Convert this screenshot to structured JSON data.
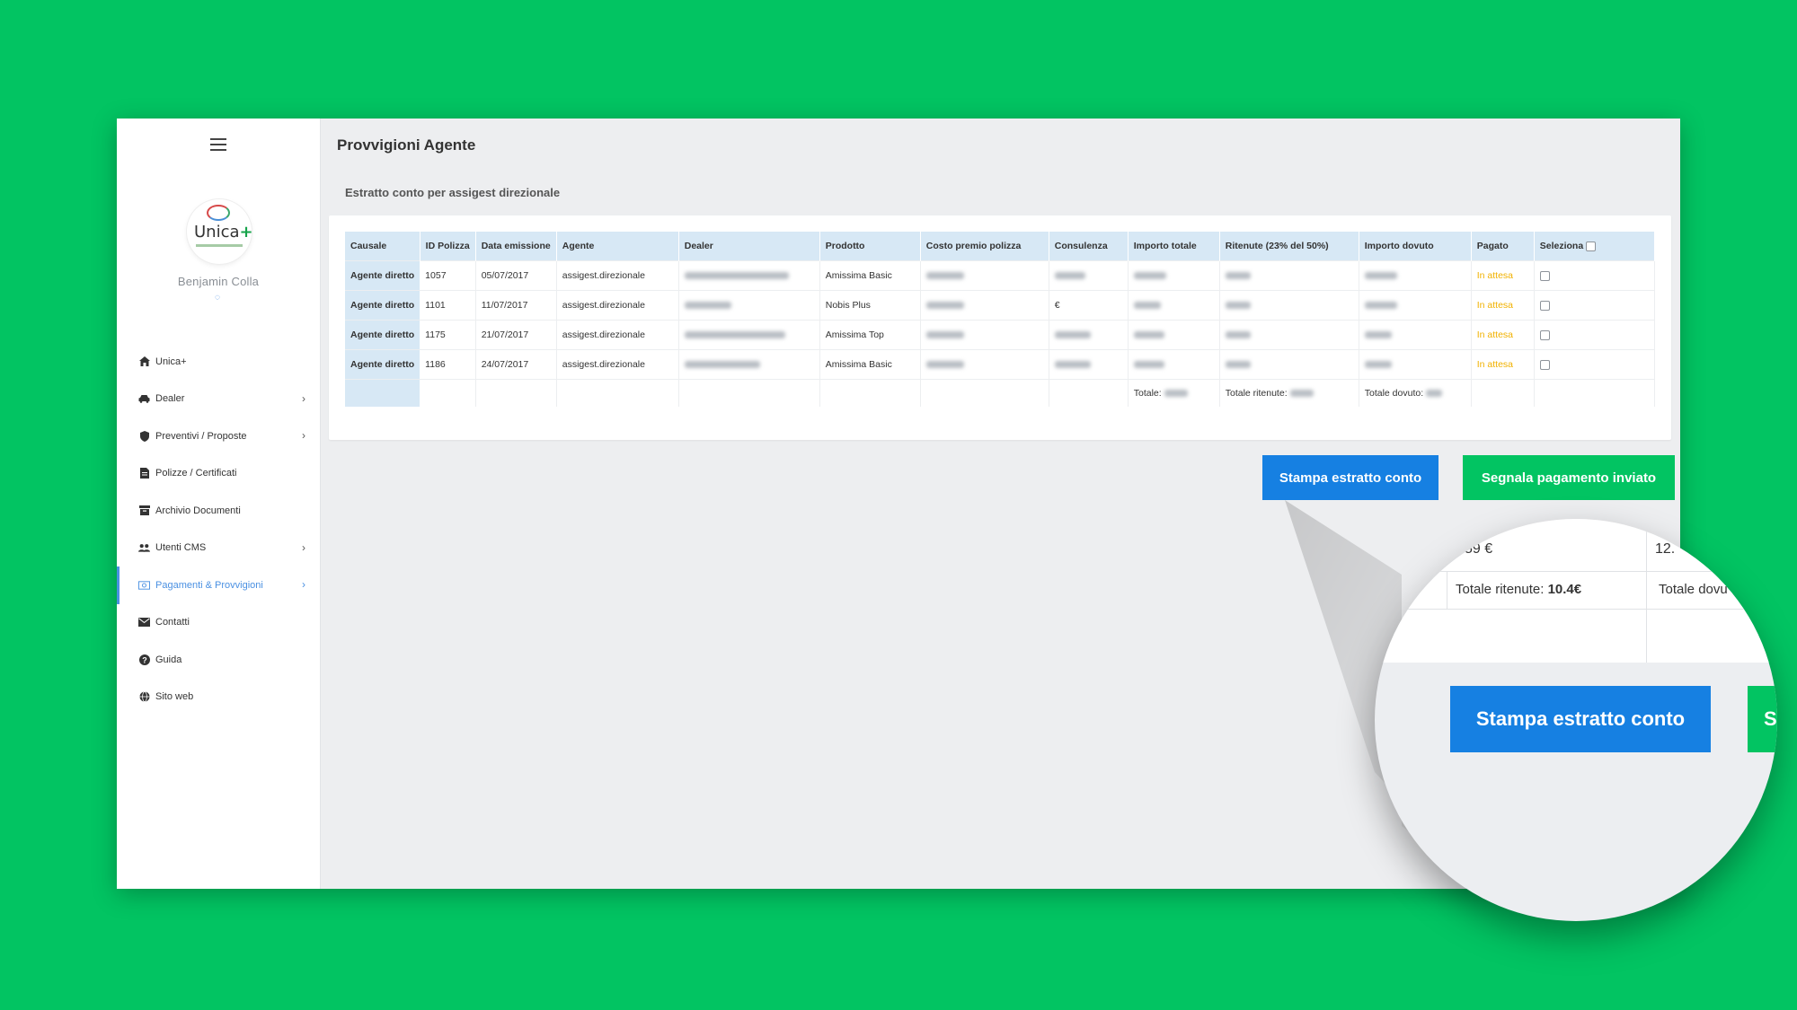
{
  "sidebar": {
    "logo_text": "Unica",
    "logo_plus": "+",
    "user_name": "Benjamin Colla",
    "status_glyph": "◌",
    "items": [
      {
        "label": "Unica+",
        "icon": "home-icon",
        "has_arrow": false
      },
      {
        "label": "Dealer",
        "icon": "car-icon",
        "has_arrow": true
      },
      {
        "label": "Preventivi / Proposte",
        "icon": "shield-icon",
        "has_arrow": true
      },
      {
        "label": "Polizze / Certificati",
        "icon": "document-icon",
        "has_arrow": false
      },
      {
        "label": "Archivio Documenti",
        "icon": "archive-icon",
        "has_arrow": false
      },
      {
        "label": "Utenti CMS",
        "icon": "users-icon",
        "has_arrow": true
      },
      {
        "label": "Pagamenti & Provvigioni",
        "icon": "money-icon",
        "has_arrow": true,
        "active": true
      },
      {
        "label": "Contatti",
        "icon": "envelope-icon",
        "has_arrow": false
      },
      {
        "label": "Guida",
        "icon": "question-icon",
        "has_arrow": false
      },
      {
        "label": "Sito web",
        "icon": "globe-icon",
        "has_arrow": false
      }
    ]
  },
  "main": {
    "title": "Provvigioni Agente",
    "subtitle": "Estratto conto per assigest direzionale"
  },
  "table": {
    "headers": [
      "Causale",
      "ID Polizza",
      "Data emissione",
      "Agente",
      "Dealer",
      "Prodotto",
      "Costo premio polizza",
      "Consulenza",
      "Importo totale",
      "Ritenute (23% del 50%)",
      "Importo dovuto",
      "Pagato",
      "Seleziona"
    ],
    "rows": [
      {
        "causale": "Agente diretto",
        "id": "1057",
        "data": "05/07/2017",
        "agente": "assigest.direzionale",
        "prodotto": "Amissima Basic",
        "consulenza": "",
        "pagato": "In attesa"
      },
      {
        "causale": "Agente diretto",
        "id": "1101",
        "data": "11/07/2017",
        "agente": "assigest.direzionale",
        "prodotto": "Nobis Plus",
        "consulenza": "€",
        "pagato": "In attesa"
      },
      {
        "causale": "Agente diretto",
        "id": "1175",
        "data": "21/07/2017",
        "agente": "assigest.direzionale",
        "prodotto": "Amissima Top",
        "consulenza": "",
        "pagato": "In attesa"
      },
      {
        "causale": "Agente diretto",
        "id": "1186",
        "data": "24/07/2017",
        "agente": "assigest.direzionale",
        "prodotto": "Amissima Basic",
        "consulenza": "",
        "pagato": "In attesa"
      }
    ],
    "totals": {
      "totale_label": "Totale:",
      "ritenute_label": "Totale ritenute:",
      "dovuto_label": "Totale dovuto:"
    }
  },
  "buttons": {
    "print": "Stampa estratto conto",
    "notify": "Segnala pagamento inviato"
  },
  "magnifier": {
    "frag_left": "59 €",
    "frag_right": "12.",
    "ritenute_label": "Totale ritenute:",
    "ritenute_value": "10.4€",
    "dovuto_label": "Totale dovu",
    "print_button": "Stampa estratto conto",
    "notify_button_partial": "S"
  },
  "colors": {
    "background": "#02c462",
    "primary_blue": "#1680e2",
    "pending": "#f1b100",
    "header_blue": "#d7e8f5"
  }
}
